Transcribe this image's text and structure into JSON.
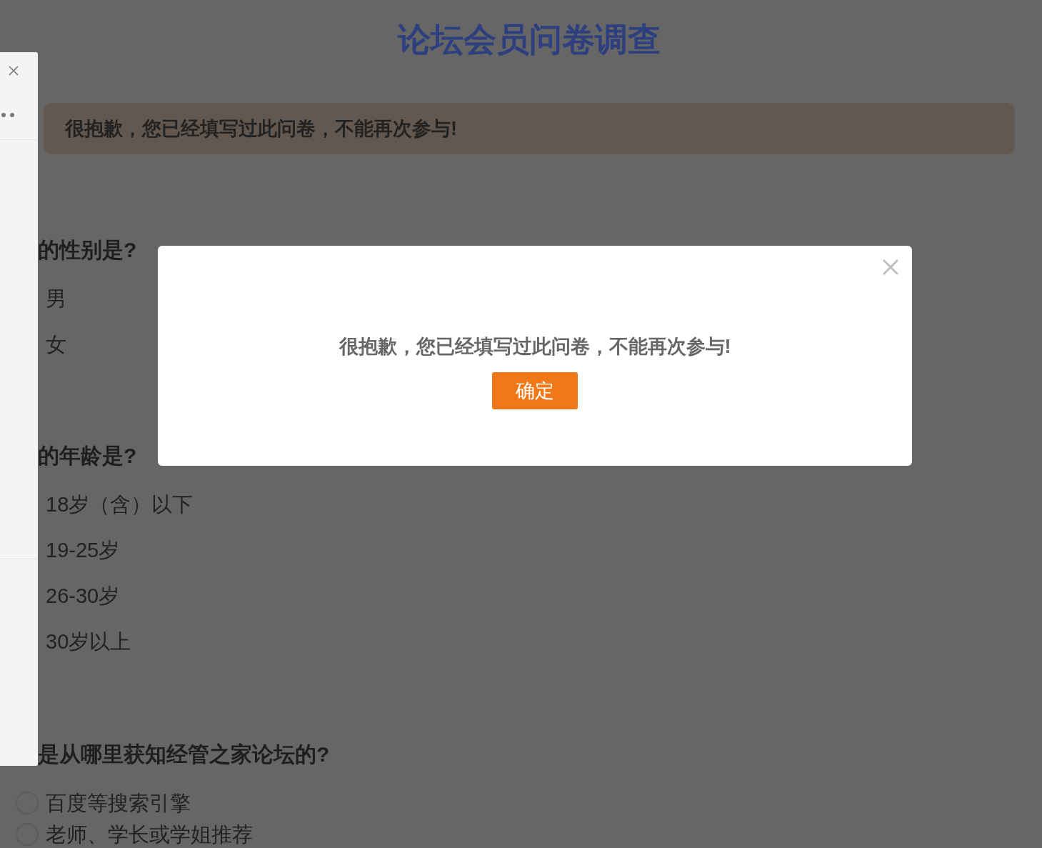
{
  "page": {
    "title": "论坛会员问卷调查",
    "notice": "很抱歉，您已经填写过此问卷，不能再次参与!"
  },
  "questions": [
    {
      "title": "的性别是?",
      "options": [
        {
          "label": "男"
        },
        {
          "label": "女"
        }
      ]
    },
    {
      "title": "的年龄是?",
      "options": [
        {
          "label": "18岁（含）以下"
        },
        {
          "label": "19-25岁"
        },
        {
          "label": "26-30岁"
        },
        {
          "label": "30岁以上"
        }
      ]
    },
    {
      "title": "是从哪里获知经管之家论坛的?",
      "options": [
        {
          "label": "百度等搜索引擎",
          "selected": false
        },
        {
          "label": "老师、学长或学姐推荐",
          "selected": false
        }
      ]
    }
  ],
  "dialog": {
    "message": "很抱歉，您已经填写过此问卷，不能再次参与!",
    "confirm": "确定"
  }
}
